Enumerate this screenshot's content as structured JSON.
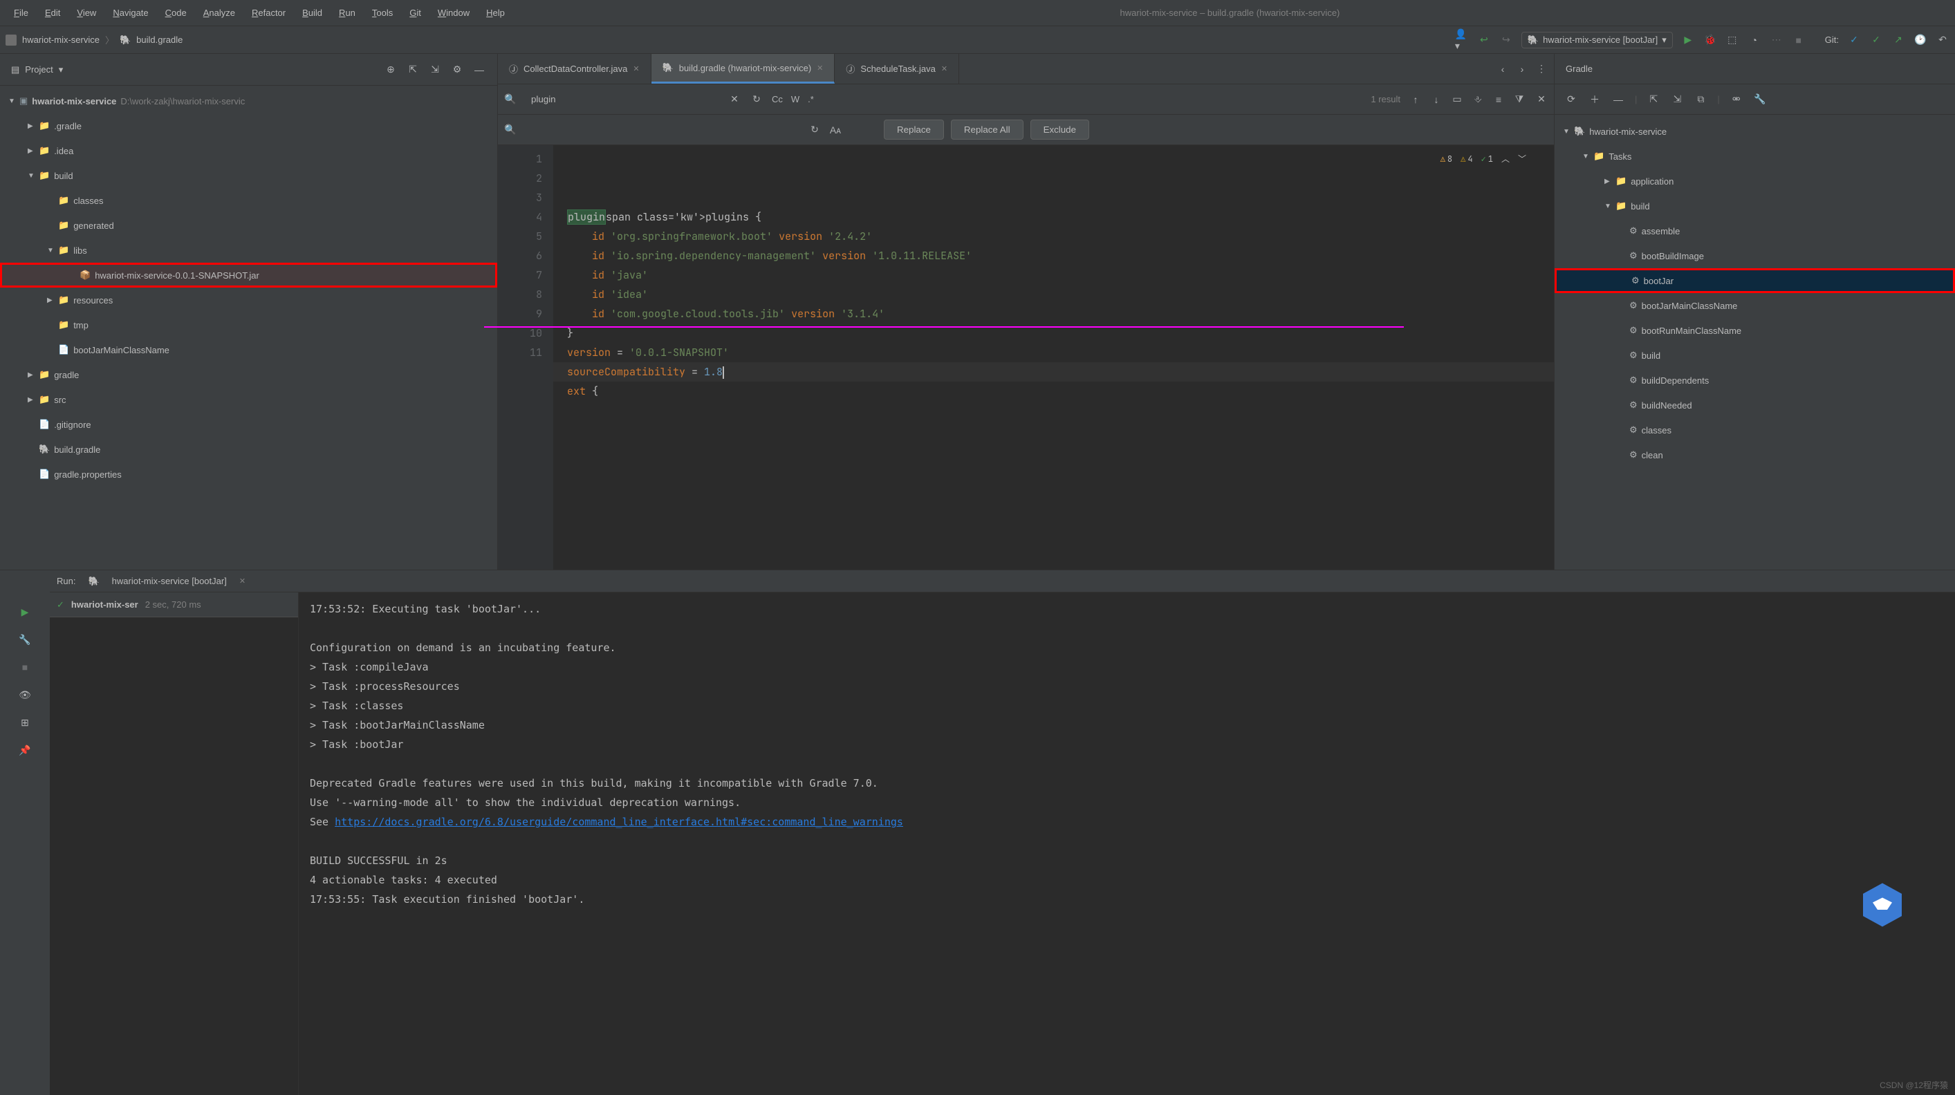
{
  "menu": [
    "File",
    "Edit",
    "View",
    "Navigate",
    "Code",
    "Analyze",
    "Refactor",
    "Build",
    "Run",
    "Tools",
    "Git",
    "Window",
    "Help"
  ],
  "window_title": "hwariot-mix-service – build.gradle (hwariot-mix-service)",
  "breadcrumb": {
    "root": "hwariot-mix-service",
    "file": "build.gradle"
  },
  "run_config": "hwariot-mix-service [bootJar]",
  "git_label": "Git:",
  "project": {
    "panel_title": "Project",
    "root": {
      "name": "hwariot-mix-service",
      "path": "D:\\work-zakj\\hwariot-mix-servic"
    },
    "items": [
      {
        "depth": 1,
        "arrow": "▶",
        "icon": "folder-orange",
        "label": ".gradle"
      },
      {
        "depth": 1,
        "arrow": "▶",
        "icon": "folder-orange",
        "label": ".idea"
      },
      {
        "depth": 1,
        "arrow": "▼",
        "icon": "folder-orange",
        "label": "build"
      },
      {
        "depth": 2,
        "arrow": "",
        "icon": "folder-orange",
        "label": "classes"
      },
      {
        "depth": 2,
        "arrow": "",
        "icon": "folder-orange",
        "label": "generated"
      },
      {
        "depth": 2,
        "arrow": "▼",
        "icon": "folder-orange",
        "label": "libs"
      },
      {
        "depth": 3,
        "arrow": "",
        "icon": "jar",
        "label": "hwariot-mix-service-0.0.1-SNAPSHOT.jar",
        "highlighted": true
      },
      {
        "depth": 2,
        "arrow": "▶",
        "icon": "folder-orange",
        "label": "resources"
      },
      {
        "depth": 2,
        "arrow": "",
        "icon": "folder-orange",
        "label": "tmp"
      },
      {
        "depth": 2,
        "arrow": "",
        "icon": "file",
        "label": "bootJarMainClassName"
      },
      {
        "depth": 1,
        "arrow": "▶",
        "icon": "folder",
        "label": "gradle"
      },
      {
        "depth": 1,
        "arrow": "▶",
        "icon": "folder",
        "label": "src"
      },
      {
        "depth": 1,
        "arrow": "",
        "icon": "file",
        "label": ".gitignore"
      },
      {
        "depth": 1,
        "arrow": "",
        "icon": "gradle",
        "label": "build.gradle"
      },
      {
        "depth": 1,
        "arrow": "",
        "icon": "file",
        "label": "gradle.properties"
      }
    ]
  },
  "tabs": [
    {
      "label": "CollectDataController.java",
      "active": false
    },
    {
      "label": "build.gradle (hwariot-mix-service)",
      "active": true
    },
    {
      "label": "ScheduleTask.java",
      "active": false
    }
  ],
  "find": {
    "query": "plugin",
    "result_text": "1 result",
    "replace_label": "Replace",
    "replace_all_label": "Replace All",
    "exclude_label": "Exclude",
    "cc": "Cc",
    "w": "W",
    "regex": ".*"
  },
  "code": {
    "lines": [
      "plugins {",
      "    id 'org.springframework.boot' version '2.4.2'",
      "    id 'io.spring.dependency-management' version '1.0.11.RELEASE'",
      "    id 'java'",
      "    id 'idea'",
      "    id 'com.google.cloud.tools.jib' version '3.1.4'",
      "}",
      "version = '0.0.1-SNAPSHOT'",
      "sourceCompatibility = 1.8",
      "",
      "ext {"
    ],
    "inspections": {
      "warn": "8",
      "weak": "4",
      "ok": "1"
    }
  },
  "gradle": {
    "title": "Gradle",
    "root": "hwariot-mix-service",
    "tasks_label": "Tasks",
    "groups": [
      {
        "label": "application",
        "expanded": false
      },
      {
        "label": "build",
        "expanded": true,
        "tasks": [
          "assemble",
          "bootBuildImage",
          "bootJar",
          "bootJarMainClassName",
          "bootRunMainClassName",
          "build",
          "buildDependents",
          "buildNeeded",
          "classes",
          "clean"
        ]
      }
    ],
    "highlighted_task": "bootJar"
  },
  "run": {
    "tab_label": "Run:",
    "config": "hwariot-mix-service [bootJar]",
    "status_name": "hwariot-mix-ser",
    "status_time": "2 sec, 720 ms",
    "console_lines": [
      "17:53:52: Executing task 'bootJar'...",
      "",
      "Configuration on demand is an incubating feature.",
      "> Task :compileJava",
      "> Task :processResources",
      "> Task :classes",
      "> Task :bootJarMainClassName",
      "> Task :bootJar",
      "",
      "Deprecated Gradle features were used in this build, making it incompatible with Gradle 7.0.",
      "Use '--warning-mode all' to show the individual deprecation warnings.",
      "See https://docs.gradle.org/6.8/userguide/command_line_interface.html#sec:command_line_warnings",
      "",
      "BUILD SUCCESSFUL in 2s",
      "4 actionable tasks: 4 executed",
      "17:53:55: Task execution finished 'bootJar'."
    ],
    "console_link": "https://docs.gradle.org/6.8/userguide/command_line_interface.html#sec:command_line_warnings"
  },
  "watermark": "CSDN @12程序猿"
}
